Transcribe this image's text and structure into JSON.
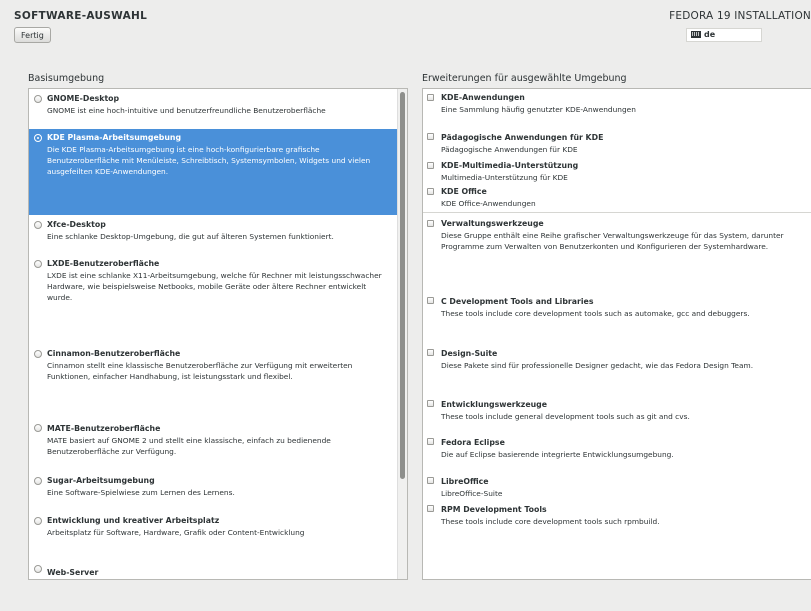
{
  "header": {
    "title": "SOFTWARE-AUSWAHL",
    "done_label": "Fertig",
    "install_title": "FEDORA 19 INSTALLATION",
    "keyboard_icon": "keyboard-icon",
    "keyboard_layout": "de"
  },
  "environments": {
    "label": "Basisumgebung",
    "items": [
      {
        "title": "GNOME-Desktop",
        "desc": "GNOME ist eine hoch-intuitive und benutzerfreundliche Benutzeroberfläche",
        "selected": false
      },
      {
        "title": "KDE Plasma-Arbeitsumgebung",
        "desc": "Die KDE Plasma-Arbeitsumgebung ist eine hoch-konfigurierbare grafische Benutzeroberfläche mit Menüleiste, Schreibtisch, Systemsymbolen, Widgets und vielen ausgefeilten KDE-Anwendungen.",
        "selected": true
      },
      {
        "title": "Xfce-Desktop",
        "desc": "Eine schlanke Desktop-Umgebung, die gut auf älteren Systemen funktioniert.",
        "selected": false
      },
      {
        "title": "LXDE-Benutzeroberfläche",
        "desc": "LXDE ist eine schlanke X11-Arbeitsumgebung, welche für Rechner mit leistungsschwacher Hardware, wie beispielsweise Netbooks, mobile Geräte oder ältere Rechner entwickelt wurde.",
        "selected": false
      },
      {
        "title": "Cinnamon-Benutzeroberfläche",
        "desc": "Cinnamon stellt eine klassische Benutzeroberfläche zur Verfügung mit erweiterten Funktionen, einfacher Handhabung, ist leistungsstark und flexibel.",
        "selected": false
      },
      {
        "title": "MATE-Benutzeroberfläche",
        "desc": "MATE basiert auf GNOME 2 und stellt eine klassische, einfach zu bedienende Benutzeroberfläche zur Verfügung.",
        "selected": false
      },
      {
        "title": "Sugar-Arbeitsumgebung",
        "desc": "Eine Software-Spielwiese zum Lernen des Lernens.",
        "selected": false
      },
      {
        "title": "Entwicklung und kreativer Arbeitsplatz",
        "desc": "Arbeitsplatz für Software, Hardware, Grafik oder Content-Entwicklung",
        "selected": false
      },
      {
        "title": "Web-Server",
        "desc": "",
        "selected": false
      }
    ]
  },
  "addons": {
    "label": "Erweiterungen für ausgewählte Umgebung",
    "items": [
      {
        "title": "KDE-Anwendungen",
        "desc": "Eine Sammlung häufig genutzter KDE-Anwendungen"
      },
      {
        "title": "Pädagogische Anwendungen für KDE",
        "desc": "Pädagogische Anwendungen für KDE"
      },
      {
        "title": "KDE-Multimedia-Unterstützung",
        "desc": "Multimedia-Unterstützung für KDE"
      },
      {
        "title": "KDE Office",
        "desc": "KDE Office-Anwendungen"
      },
      {
        "title": "Verwaltungswerkzeuge",
        "desc": "Diese Gruppe enthält eine Reihe grafischer Verwaltungswerkzeuge für das System, darunter Programme zum Verwalten von Benutzerkonten und Konfigurieren der Systemhardware."
      },
      {
        "title": "C Development Tools and Libraries",
        "desc": "These tools include core development tools such as automake, gcc and debuggers."
      },
      {
        "title": "Design-Suite",
        "desc": "Diese Pakete sind für professionelle Designer gedacht, wie das Fedora Design Team."
      },
      {
        "title": "Entwicklungswerkzeuge",
        "desc": "These tools include general development tools such as git and cvs."
      },
      {
        "title": "Fedora Eclipse",
        "desc": "Die auf Eclipse basierende integrierte Entwicklungsumgebung."
      },
      {
        "title": "LibreOffice",
        "desc": "LibreOffice-Suite"
      },
      {
        "title": "RPM Development Tools",
        "desc": "These tools include core development tools such rpmbuild."
      }
    ]
  }
}
